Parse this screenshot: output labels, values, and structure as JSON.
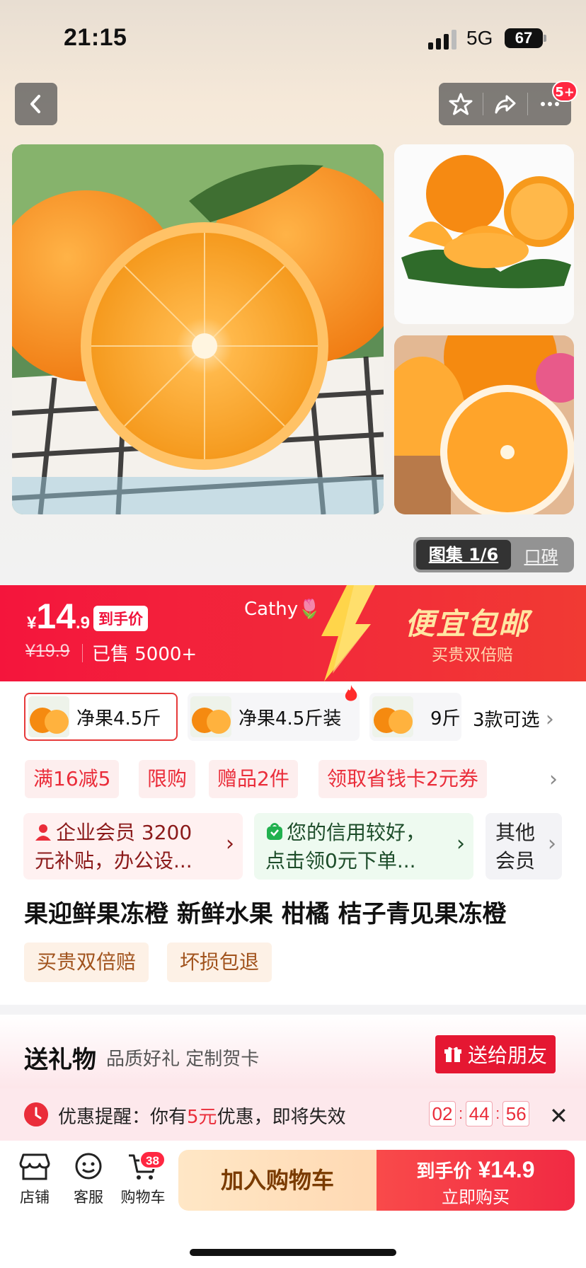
{
  "status_bar": {
    "time": "21:15",
    "network": "5G",
    "battery": "67"
  },
  "nav": {
    "notification_badge": "5+"
  },
  "gallery": {
    "active_label": "图集 1/6",
    "reviews_label": "口碑"
  },
  "price_banner": {
    "currency": "¥",
    "price_int": "14",
    "price_dec": ".9",
    "tag": "到手价",
    "original_price": "¥19.9",
    "sold": "已售 5000+",
    "user_name": "Cathy🌷",
    "promo_title": "便宜包邮",
    "promo_sub": "买贵双倍赔"
  },
  "skus": [
    {
      "label": "净果4.5斤"
    },
    {
      "label": "净果4.5斤装"
    },
    {
      "label": "9斤"
    }
  ],
  "sku_more": "3款可选",
  "coupons": [
    "满16减5",
    "限购",
    "赠品2件",
    "领取省钱卡2元券"
  ],
  "members": [
    {
      "line1": "企业会员 3200",
      "line2": "元补贴，办公设..."
    },
    {
      "line1": "您的信用较好，",
      "line2": "点击领0元下单..."
    },
    {
      "line1": "其他",
      "line2": "会员"
    }
  ],
  "product": {
    "title": "果迎鲜果冻橙 新鲜水果 柑橘 桔子青见果冻橙",
    "tags": [
      "买贵双倍赔",
      "坏损包退"
    ]
  },
  "gift": {
    "title": "送礼物",
    "subtitle": "品质好礼 定制贺卡",
    "button": "送给朋友"
  },
  "reminder": {
    "prefix": "优惠提醒：你有",
    "amount": "5元",
    "suffix": "优惠，即将失效",
    "timer": [
      "02",
      "44",
      "56"
    ]
  },
  "bottom": {
    "shop": "店铺",
    "service": "客服",
    "cart": "购物车",
    "cart_count": "38",
    "add_cart": "加入购物车",
    "buy_price_label": "到手价",
    "buy_price": "¥14.9",
    "buy_now": "立即购买"
  },
  "colors": {
    "primary_red": "#f4153c",
    "promo_yellow": "#ffe6a3",
    "coupon_bg": "#fdeeee"
  }
}
